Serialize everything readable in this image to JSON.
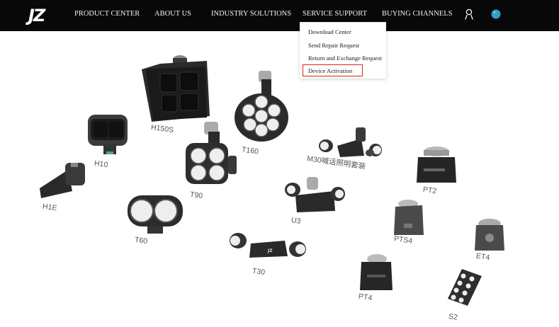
{
  "brand": {
    "logo_text": "JZ"
  },
  "nav": {
    "items": [
      {
        "id": "products",
        "label": "PRODUCT CENTER"
      },
      {
        "id": "about",
        "label": "ABOUT US"
      },
      {
        "id": "solutions",
        "label": "INDUSTRY SOLUTIONS"
      },
      {
        "id": "support",
        "label": "SERVICE SUPPORT"
      },
      {
        "id": "buying",
        "label": "BUYING CHANNELS"
      }
    ],
    "icons": [
      "user-icon",
      "globe-icon"
    ]
  },
  "dropdown": {
    "items": [
      {
        "label": "Download Center"
      },
      {
        "label": "Send Repair Request"
      },
      {
        "label": "Return and Exchange Request"
      },
      {
        "label": "Device Activation",
        "highlighted": true
      }
    ],
    "highlight_color": "#d9231f"
  },
  "products": {
    "labels": [
      "H150S",
      "T160",
      "H10",
      "M30喊话照明套装",
      "T90",
      "PT2",
      "H1E",
      "U3",
      "PTS4",
      "ET4",
      "T60",
      "T30",
      "PT4",
      "S2"
    ]
  },
  "colors": {
    "nav_bg": "#080808",
    "nav_text": "#f2f2f2",
    "accent": "#d9231f"
  }
}
